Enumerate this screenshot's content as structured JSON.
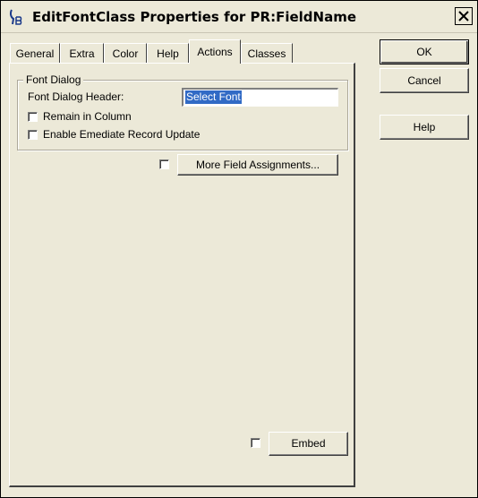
{
  "window": {
    "title": "EditFontClass Properties for PR:FieldName"
  },
  "tabs": [
    {
      "label": "General",
      "active": false
    },
    {
      "label": "Extra",
      "active": false
    },
    {
      "label": "Color",
      "active": false
    },
    {
      "label": "Help",
      "active": false
    },
    {
      "label": "Actions",
      "active": true
    },
    {
      "label": "Classes",
      "active": false
    }
  ],
  "actions_tab": {
    "group_title": "Font Dialog",
    "header_label": "Font Dialog Header:",
    "header_value": "Select Font",
    "remain_in_column": {
      "label": "Remain in Column",
      "checked": false
    },
    "enable_update": {
      "label": "Enable Emediate Record Update",
      "checked": false
    },
    "more_assignments": {
      "label": "More Field Assignments...",
      "checked": false
    },
    "embed": {
      "label": "Embed",
      "checked": false
    }
  },
  "buttons": {
    "ok": "OK",
    "cancel": "Cancel",
    "help": "Help"
  }
}
